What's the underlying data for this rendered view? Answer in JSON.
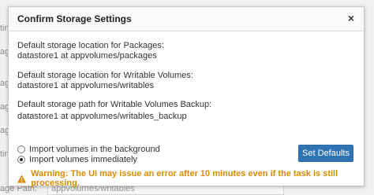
{
  "background": {
    "labels": [
      "ting",
      "age",
      "age",
      "age",
      "age",
      "ting",
      "age Path:"
    ],
    "field_value": "appvolumes/writables"
  },
  "dialog": {
    "title": "Confirm Storage Settings",
    "close_glyph": "×",
    "packages": {
      "label": "Default storage location for Packages:",
      "value": "datastore1 at appvolumes/packages"
    },
    "writables": {
      "label": "Default storage location for Writable Volumes:",
      "value": "datastore1 at appvolumes/writables"
    },
    "backup": {
      "label": "Default storage path for Writable Volumes Backup:",
      "value": "datastore1 at appvolumes/writables_backup"
    },
    "import_options": [
      {
        "label": "Import volumes in the background",
        "checked": false
      },
      {
        "label": "Import volumes immediately",
        "checked": true
      }
    ],
    "set_defaults_label": "Set Defaults",
    "warning_text": "Warning: The UI may issue an error after 10 minutes even if the task is still processing.",
    "warning_icon": "warning-triangle-icon"
  },
  "colors": {
    "primary": "#2e74b5",
    "warning": "#d98c00"
  }
}
